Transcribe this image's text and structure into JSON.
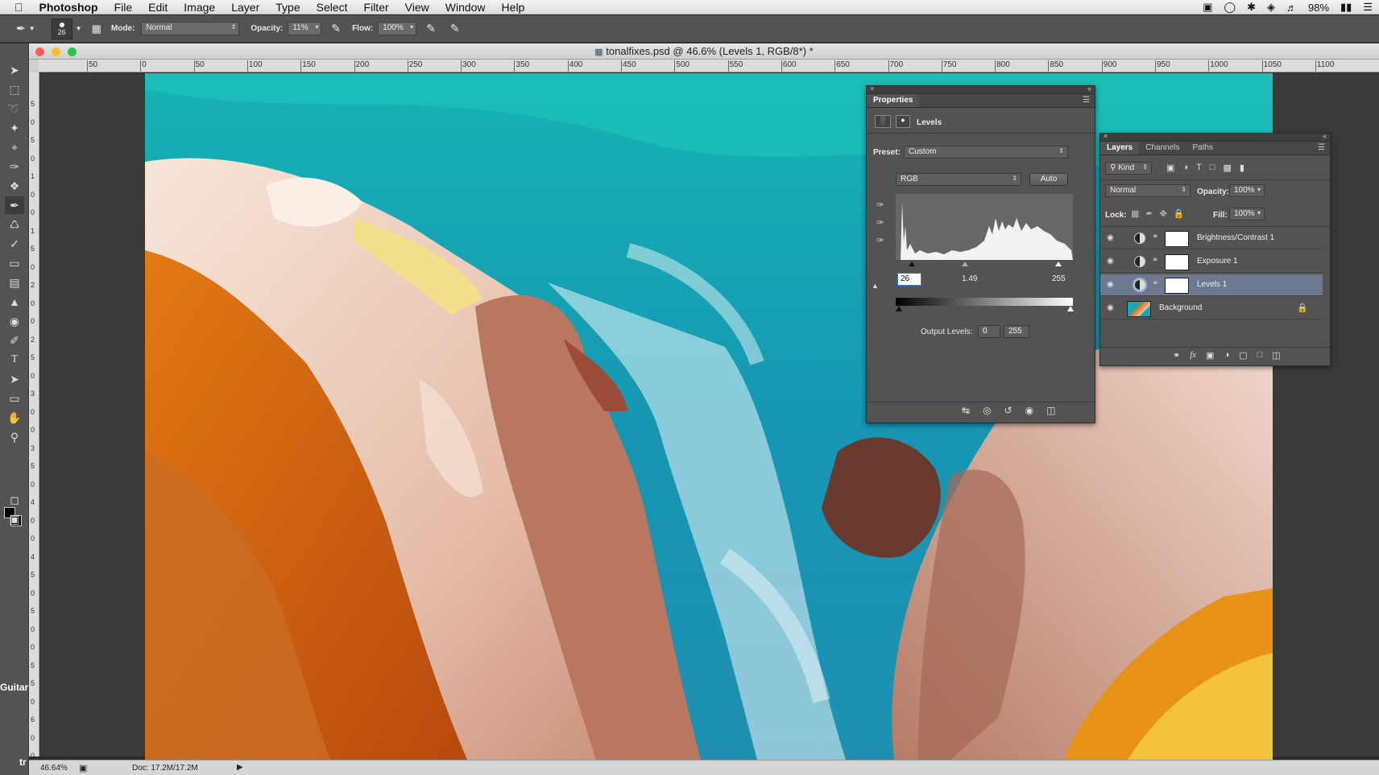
{
  "menubar": {
    "apple": "",
    "app": "Photoshop",
    "items": [
      "File",
      "Edit",
      "Image",
      "Layer",
      "Type",
      "Select",
      "Filter",
      "View",
      "Window",
      "Help"
    ],
    "battery": "98%"
  },
  "options": {
    "brush_size": "26",
    "mode_label": "Mode:",
    "mode_value": "Normal",
    "opacity_label": "Opacity:",
    "opacity_value": "11%",
    "flow_label": "Flow:",
    "flow_value": "100%"
  },
  "document": {
    "title": "tonalfixes.psd @ 46.6% (Levels 1, RGB/8*) *",
    "ruler_h": [
      "50",
      "0",
      "50",
      "100",
      "150",
      "200",
      "250",
      "300",
      "350",
      "400",
      "450",
      "500",
      "550",
      "600",
      "650",
      "700",
      "750",
      "800",
      "850",
      "900",
      "950",
      "1000",
      "1050",
      "1100"
    ],
    "ruler_v": [
      "5",
      "0",
      "5",
      "0",
      "1",
      "0",
      "0",
      "1",
      "5",
      "0",
      "2",
      "0",
      "0",
      "2",
      "5",
      "0",
      "3",
      "0",
      "0",
      "3",
      "5",
      "0",
      "4",
      "0",
      "0",
      "4",
      "5",
      "0",
      "5",
      "0",
      "0",
      "5",
      "5",
      "0",
      "6",
      "0",
      "0"
    ]
  },
  "status": {
    "zoom": "46.64%",
    "doc": "Doc: 17.2M/17.2M"
  },
  "side_fragments": {
    "guitar": "Guitar",
    "tr": "tr"
  },
  "properties": {
    "tab": "Properties",
    "type": "Levels",
    "preset_label": "Preset:",
    "preset_value": "Custom",
    "channel": "RGB",
    "auto": "Auto",
    "input_black": "26",
    "input_gamma": "1.49",
    "input_white": "255",
    "output_label": "Output Levels:",
    "output_black": "0",
    "output_white": "255"
  },
  "layers_panel": {
    "tabs": [
      "Layers",
      "Channels",
      "Paths"
    ],
    "kind": "Kind",
    "blend": "Normal",
    "opacity_label": "Opacity:",
    "opacity_value": "100%",
    "lock_label": "Lock:",
    "fill_label": "Fill:",
    "fill_value": "100%",
    "layers": [
      {
        "name": "Brightness/Contrast 1",
        "selected": false
      },
      {
        "name": "Exposure 1",
        "selected": false
      },
      {
        "name": "Levels 1",
        "selected": true
      },
      {
        "name": "Background",
        "selected": false
      }
    ]
  },
  "colors": {
    "panel_bg": "#535353",
    "selected_layer": "#6d7891",
    "sea": "#1aa9b4",
    "rock": "#e7c2b4",
    "moss": "#d36c12"
  }
}
